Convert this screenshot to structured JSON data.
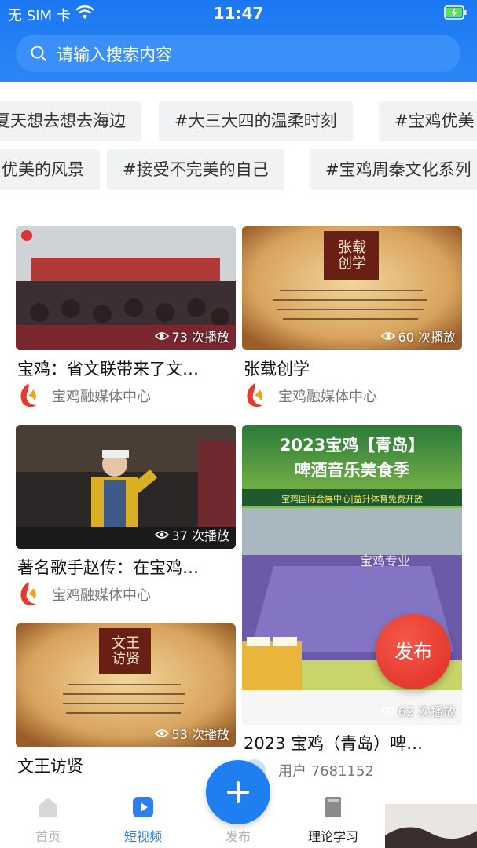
{
  "status_bar": {
    "carrier": "无 SIM 卡",
    "time": "11:47"
  },
  "search": {
    "placeholder": "请输入搜索内容"
  },
  "tags_row1": [
    "夏天想去想去海边",
    "#大三大四的温柔时刻",
    "#宝鸡优美"
  ],
  "tags_row2": [
    "优美的风景",
    "#接受不完美的自己",
    "#宝鸡周秦文化系列"
  ],
  "cards": [
    {
      "title": "宝鸡：省文联带来了文…",
      "views": "73 次播放",
      "author": "宝鸡融媒体中心"
    },
    {
      "title": "张载创学",
      "views": "60 次播放",
      "author": "宝鸡融媒体中心",
      "thumb_text": "张载创学"
    },
    {
      "title": "著名歌手赵传：在宝鸡…",
      "views": "37 次播放",
      "author": "宝鸡融媒体中心"
    },
    {
      "title": "2023 宝鸡（青岛）啤…",
      "views": "62 次播放",
      "author": "用户 7681152",
      "thumb_headline1": "2023宝鸡【青岛】",
      "thumb_headline2": "啤酒音乐美食季",
      "thumb_banner": "宝鸡国际会展中心|益升体育免费开放",
      "thumb_watermark": "宝鸡专业"
    },
    {
      "title": "文王访贤",
      "views": "53 次播放",
      "author": "",
      "thumb_text": "文王访贤"
    }
  ],
  "fab_publish": "发布",
  "nav": [
    {
      "label": "首页",
      "icon": "home-icon"
    },
    {
      "label": "短视频",
      "icon": "video-icon"
    },
    {
      "label": "发布",
      "icon": "add-icon"
    },
    {
      "label": "理论学习",
      "icon": "book-icon"
    }
  ],
  "colors": {
    "brand": "#1f7ef0",
    "publish": "#e53a2e"
  }
}
